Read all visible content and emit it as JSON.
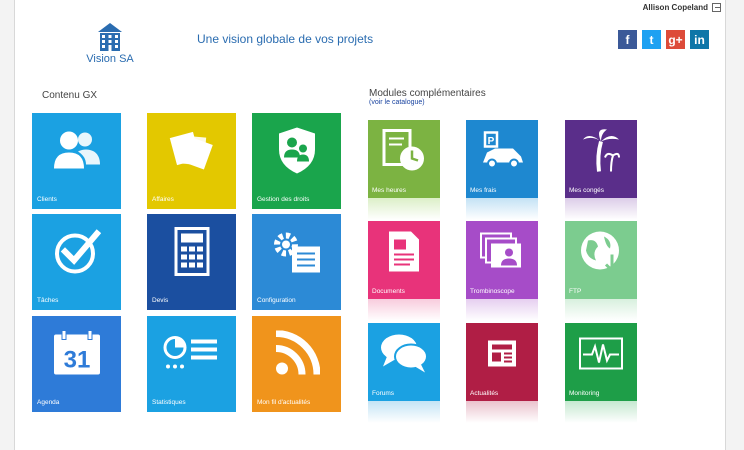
{
  "user": {
    "name": "Allison Copeland"
  },
  "brand": {
    "name": "Vision SA",
    "tagline": "Une vision globale de vos projets"
  },
  "social": [
    {
      "icon": "facebook-icon",
      "glyph": "f",
      "color": "#3b5998"
    },
    {
      "icon": "twitter-icon",
      "glyph": "t",
      "color": "#1da1f2"
    },
    {
      "icon": "google-plus-icon",
      "glyph": "g+",
      "color": "#dd4b39"
    },
    {
      "icon": "linkedin-icon",
      "glyph": "in",
      "color": "#0e76a8"
    }
  ],
  "content": {
    "title": "Contenu GX",
    "tiles": [
      {
        "label": "Clients",
        "icon": "users-icon",
        "color": "#1ba1e2"
      },
      {
        "label": "Affaires",
        "icon": "documents-icon",
        "color": "#e3c800"
      },
      {
        "label": "Gestion des droits",
        "icon": "shield-user-icon",
        "color": "#1aa54c"
      },
      {
        "label": "Tâches",
        "icon": "check-icon",
        "color": "#1ba1e2"
      },
      {
        "label": "Devis",
        "icon": "calculator-icon",
        "color": "#1b4fa0"
      },
      {
        "label": "Configuration",
        "icon": "gear-list-icon",
        "color": "#2c8ad6"
      },
      {
        "label": "Agenda",
        "icon": "calendar-icon",
        "color": "#2e7bd8",
        "day": "31"
      },
      {
        "label": "Statistiques",
        "icon": "chart-list-icon",
        "color": "#1ba1e2"
      },
      {
        "label": "Mon fil d'actualités",
        "icon": "rss-icon",
        "color": "#f0941c"
      }
    ]
  },
  "modules": {
    "title": "Modules complémentaires",
    "catalog_link": "(voir le catalogue)",
    "tiles": [
      {
        "label": "Mes heures",
        "icon": "clock-doc-icon",
        "color": "#7cb342",
        "fade": "#dcefc8"
      },
      {
        "label": "Mes frais",
        "icon": "car-parking-icon",
        "color": "#1e88d0",
        "fade": "#c4e2f5"
      },
      {
        "label": "Mes congés",
        "icon": "palm-tree-icon",
        "color": "#5a2e8a",
        "fade": "#dccde8"
      },
      {
        "label": "Documents",
        "icon": "document-icon",
        "color": "#e8337a",
        "fade": "#f8ccdd"
      },
      {
        "label": "Trombinoscope",
        "icon": "photo-stack-icon",
        "color": "#a64cc8",
        "fade": "#e6cff0"
      },
      {
        "label": "FTP",
        "icon": "globe-arrow-icon",
        "color": "#7ccc8f",
        "fade": "#d8f0de"
      },
      {
        "label": "Forums",
        "icon": "chat-bubbles-icon",
        "color": "#1ba1e2",
        "fade": "#c4e4f5"
      },
      {
        "label": "Actualités",
        "icon": "newspaper-icon",
        "color": "#b01e45",
        "fade": "#eac2cd"
      },
      {
        "label": "Monitoring",
        "icon": "pulse-monitor-icon",
        "color": "#1e9e48",
        "fade": "#c5e8d0"
      }
    ]
  }
}
